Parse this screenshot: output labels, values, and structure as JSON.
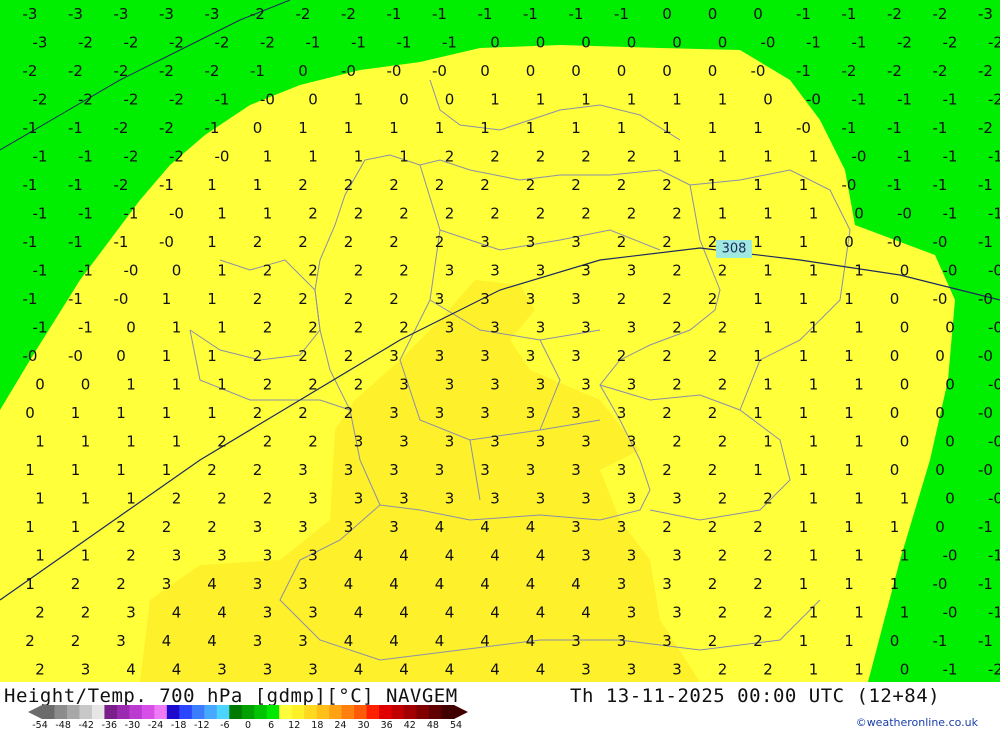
{
  "title_left": "Height/Temp. 700 hPa [gdmp][°C] NAVGEM",
  "title_right": "Th 13-11-2025 00:00 UTC (12+84)",
  "credit": "©weatheronline.co.uk",
  "isohypse_label": "308",
  "legend": {
    "ticks": [
      "-54",
      "-48",
      "-42",
      "-36",
      "-30",
      "-24",
      "-18",
      "-12",
      "-6",
      "0",
      "6",
      "12",
      "18",
      "24",
      "30",
      "36",
      "42",
      "48",
      "54"
    ],
    "colors": [
      "#6b6b6b",
      "#8c8c8c",
      "#a8a8a8",
      "#c8c8c8",
      "#e6e6e6",
      "#7a1e8a",
      "#9a2ab0",
      "#bb3ad0",
      "#d84fe8",
      "#ee7af5",
      "#1e0acd",
      "#2a46ff",
      "#3c7cff",
      "#46a8ff",
      "#4cd4ff",
      "#007a00",
      "#00a000",
      "#00c400",
      "#00e800",
      "#ffff3a",
      "#fff028",
      "#ffd820",
      "#ffc01a",
      "#ffa214",
      "#ff800e",
      "#ff5a08",
      "#ff2000",
      "#e00000",
      "#c00000",
      "#a00000",
      "#800000",
      "#600000",
      "#400000"
    ]
  },
  "map_colors": {
    "band_negative": "#00ee00",
    "band_0_3": "#ffff3a",
    "band_3_plus": "#fff02c",
    "borders": "#8a8fa8",
    "isohypse": "#1c2a5e"
  },
  "grid_values": [
    [
      "-3",
      "-3",
      "-3",
      "-3",
      "-3",
      "-2",
      "-2",
      "-2",
      "-1",
      "-1",
      "-1",
      "-1",
      "-1",
      "-1",
      "0",
      "0",
      "0",
      "-1",
      "-1",
      "-2",
      "-2",
      "-3"
    ],
    [
      "-3",
      "-2",
      "-2",
      "-2",
      "-2",
      "-2",
      "-1",
      "-1",
      "-1",
      "-1",
      "0",
      "0",
      "0",
      "0",
      "0",
      "0",
      "-0",
      "-1",
      "-1",
      "-2",
      "-2",
      "-2"
    ],
    [
      "-2",
      "-2",
      "-2",
      "-2",
      "-2",
      "-1",
      "0",
      "-0",
      "-0",
      "-0",
      "0",
      "0",
      "0",
      "0",
      "0",
      "0",
      "-0",
      "-1",
      "-2",
      "-2",
      "-2",
      "-2"
    ],
    [
      "-2",
      "-2",
      "-2",
      "-2",
      "-1",
      "-0",
      "0",
      "1",
      "0",
      "0",
      "1",
      "1",
      "1",
      "1",
      "1",
      "1",
      "0",
      "-0",
      "-1",
      "-1",
      "-1",
      "-2"
    ],
    [
      "-1",
      "-1",
      "-2",
      "-2",
      "-1",
      "0",
      "1",
      "1",
      "1",
      "1",
      "1",
      "1",
      "1",
      "1",
      "1",
      "1",
      "1",
      "-0",
      "-1",
      "-1",
      "-1",
      "-2"
    ],
    [
      "-1",
      "-1",
      "-2",
      "-2",
      "-0",
      "1",
      "1",
      "1",
      "1",
      "2",
      "2",
      "2",
      "2",
      "2",
      "1",
      "1",
      "1",
      "1",
      "-0",
      "-1",
      "-1",
      "-1"
    ],
    [
      "-1",
      "-1",
      "-2",
      "-1",
      "1",
      "1",
      "2",
      "2",
      "2",
      "2",
      "2",
      "2",
      "2",
      "2",
      "2",
      "1",
      "1",
      "1",
      "-0",
      "-1",
      "-1",
      "-1"
    ],
    [
      "-1",
      "-1",
      "-1",
      "-0",
      "1",
      "1",
      "2",
      "2",
      "2",
      "2",
      "2",
      "2",
      "2",
      "2",
      "2",
      "1",
      "1",
      "1",
      "0",
      "-0",
      "-1",
      "-1"
    ],
    [
      "-1",
      "-1",
      "-1",
      "-0",
      "1",
      "2",
      "2",
      "2",
      "2",
      "2",
      "3",
      "3",
      "3",
      "2",
      "2",
      "2",
      "1",
      "1",
      "0",
      "-0",
      "-0",
      "-1"
    ],
    [
      "-1",
      "-1",
      "-0",
      "0",
      "1",
      "2",
      "2",
      "2",
      "2",
      "3",
      "3",
      "3",
      "3",
      "3",
      "2",
      "2",
      "1",
      "1",
      "1",
      "0",
      "-0",
      "-0"
    ],
    [
      "-1",
      "-1",
      "-0",
      "1",
      "1",
      "2",
      "2",
      "2",
      "2",
      "3",
      "3",
      "3",
      "3",
      "2",
      "2",
      "2",
      "1",
      "1",
      "1",
      "0",
      "-0",
      "-0"
    ],
    [
      "-1",
      "-1",
      "0",
      "1",
      "1",
      "2",
      "2",
      "2",
      "2",
      "3",
      "3",
      "3",
      "3",
      "3",
      "2",
      "2",
      "1",
      "1",
      "1",
      "0",
      "0",
      "-0"
    ],
    [
      "-0",
      "-0",
      "0",
      "1",
      "1",
      "2",
      "2",
      "2",
      "3",
      "3",
      "3",
      "3",
      "3",
      "2",
      "2",
      "2",
      "1",
      "1",
      "1",
      "0",
      "0",
      "-0"
    ],
    [
      "0",
      "0",
      "1",
      "1",
      "1",
      "2",
      "2",
      "2",
      "3",
      "3",
      "3",
      "3",
      "3",
      "3",
      "2",
      "2",
      "1",
      "1",
      "1",
      "0",
      "0",
      "-0"
    ],
    [
      "0",
      "1",
      "1",
      "1",
      "1",
      "2",
      "2",
      "2",
      "3",
      "3",
      "3",
      "3",
      "3",
      "3",
      "2",
      "2",
      "1",
      "1",
      "1",
      "0",
      "0",
      "-0"
    ],
    [
      "1",
      "1",
      "1",
      "1",
      "2",
      "2",
      "2",
      "3",
      "3",
      "3",
      "3",
      "3",
      "3",
      "3",
      "2",
      "2",
      "1",
      "1",
      "1",
      "0",
      "0",
      "-0"
    ],
    [
      "1",
      "1",
      "1",
      "1",
      "2",
      "2",
      "3",
      "3",
      "3",
      "3",
      "3",
      "3",
      "3",
      "3",
      "2",
      "2",
      "1",
      "1",
      "1",
      "0",
      "0",
      "-0"
    ],
    [
      "1",
      "1",
      "1",
      "2",
      "2",
      "2",
      "3",
      "3",
      "3",
      "3",
      "3",
      "3",
      "3",
      "3",
      "3",
      "2",
      "2",
      "1",
      "1",
      "1",
      "0",
      "-0"
    ],
    [
      "1",
      "1",
      "2",
      "2",
      "2",
      "3",
      "3",
      "3",
      "3",
      "4",
      "4",
      "4",
      "3",
      "3",
      "2",
      "2",
      "2",
      "1",
      "1",
      "1",
      "0",
      "-1"
    ],
    [
      "1",
      "1",
      "2",
      "3",
      "3",
      "3",
      "3",
      "4",
      "4",
      "4",
      "4",
      "4",
      "3",
      "3",
      "3",
      "2",
      "2",
      "1",
      "1",
      "1",
      "-0",
      "-1"
    ],
    [
      "1",
      "2",
      "2",
      "3",
      "4",
      "3",
      "3",
      "4",
      "4",
      "4",
      "4",
      "4",
      "4",
      "3",
      "3",
      "2",
      "2",
      "1",
      "1",
      "1",
      "-0",
      "-1"
    ],
    [
      "2",
      "2",
      "3",
      "4",
      "4",
      "3",
      "3",
      "4",
      "4",
      "4",
      "4",
      "4",
      "4",
      "3",
      "3",
      "2",
      "2",
      "1",
      "1",
      "1",
      "-0",
      "-1"
    ],
    [
      "2",
      "2",
      "3",
      "4",
      "4",
      "3",
      "3",
      "4",
      "4",
      "4",
      "4",
      "4",
      "3",
      "3",
      "3",
      "2",
      "2",
      "1",
      "1",
      "0",
      "-1",
      "-1"
    ],
    [
      "2",
      "3",
      "4",
      "4",
      "3",
      "3",
      "3",
      "4",
      "4",
      "4",
      "4",
      "4",
      "3",
      "3",
      "3",
      "2",
      "2",
      "1",
      "1",
      "0",
      "-1",
      "-2"
    ]
  ]
}
